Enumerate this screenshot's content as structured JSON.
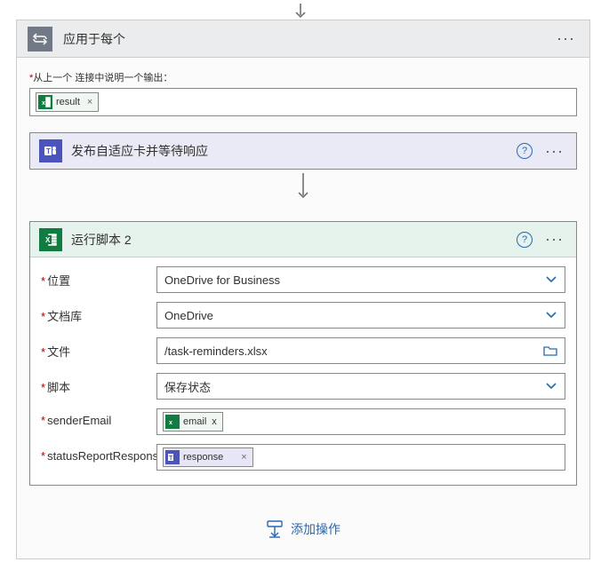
{
  "topLabel": "从上一个 连接中说明一个输出：",
  "foreach": {
    "title": "应用于每个",
    "resultToken": "result"
  },
  "teamsStep": {
    "title": "发布自适应卡并等待响应"
  },
  "excelStep": {
    "title": "运行脚本 2",
    "fields": {
      "locationLabel": "位置",
      "locationValue": "OneDrive for Business",
      "libraryLabel": "文档库",
      "libraryValue": "OneDrive",
      "fileLabel": "文件",
      "fileValue": "/task-reminders.xlsx",
      "scriptLabel": "脚本",
      "scriptValue": "保存状态",
      "senderLabel": "senderEmail",
      "senderToken": "email",
      "statusLabel": "statusReportResponse",
      "statusToken": "response"
    }
  },
  "addAction": "添加操作"
}
